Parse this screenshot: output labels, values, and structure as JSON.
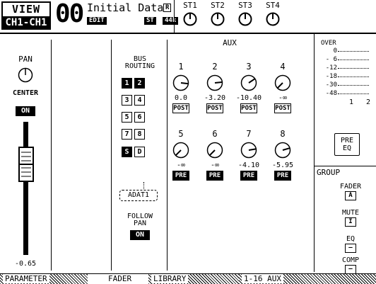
{
  "header": {
    "view_label": "VIEW",
    "channel_label": "CH1-CH1",
    "scene_number": "00",
    "scene_title": "Initial Data",
    "edit_tag": "EDIT",
    "r_tag": "R",
    "st_tag": "ST",
    "khz_tag": "44k",
    "stereo_knobs": [
      "ST1",
      "ST2",
      "ST3",
      "ST4"
    ]
  },
  "pan": {
    "label": "PAN",
    "position": "CENTER",
    "on_label": "ON",
    "fader_value": "-0.65"
  },
  "bus_routing": {
    "title_line1": "BUS",
    "title_line2": "ROUTING",
    "buttons": [
      {
        "label": "1",
        "on": true
      },
      {
        "label": "2",
        "on": true
      },
      {
        "label": "3",
        "on": false
      },
      {
        "label": "4",
        "on": false
      },
      {
        "label": "5",
        "on": false
      },
      {
        "label": "6",
        "on": false
      },
      {
        "label": "7",
        "on": false
      },
      {
        "label": "8",
        "on": false
      },
      {
        "label": "S",
        "on": true
      },
      {
        "label": "D",
        "on": false
      }
    ],
    "direct_out": "ADAT1",
    "follow_pan_line1": "FOLLOW",
    "follow_pan_line2": "PAN",
    "follow_pan_state": "ON"
  },
  "aux": {
    "title": "AUX",
    "sends": [
      {
        "num": "1",
        "value": "0.0",
        "mode": "POST"
      },
      {
        "num": "2",
        "value": "-3.20",
        "mode": "POST"
      },
      {
        "num": "3",
        "value": "-10.40",
        "mode": "POST"
      },
      {
        "num": "4",
        "value": "-∞",
        "mode": "POST"
      },
      {
        "num": "5",
        "value": "-∞",
        "mode": "PRE"
      },
      {
        "num": "6",
        "value": "-∞",
        "mode": "PRE"
      },
      {
        "num": "7",
        "value": "-4.10",
        "mode": "PRE"
      },
      {
        "num": "8",
        "value": "-5.95",
        "mode": "PRE"
      }
    ]
  },
  "meter": {
    "labels": [
      "OVER",
      "0",
      "- 6",
      "-12",
      "-18",
      "-30",
      "-48"
    ],
    "channels": [
      "1",
      "2"
    ],
    "pre_eq_line1": "PRE",
    "pre_eq_line2": "EQ"
  },
  "group": {
    "title": "GROUP",
    "items": [
      {
        "label": "FADER",
        "value": "A"
      },
      {
        "label": "MUTE",
        "value": "I"
      },
      {
        "label": "EQ",
        "value": "—"
      },
      {
        "label": "COMP",
        "value": "—"
      }
    ]
  },
  "tabs": [
    "PARAMETER",
    "FADER",
    "LIBRARY",
    "1-16 AUX"
  ],
  "colors": {
    "ink": "#000000",
    "paper": "#ffffff"
  }
}
